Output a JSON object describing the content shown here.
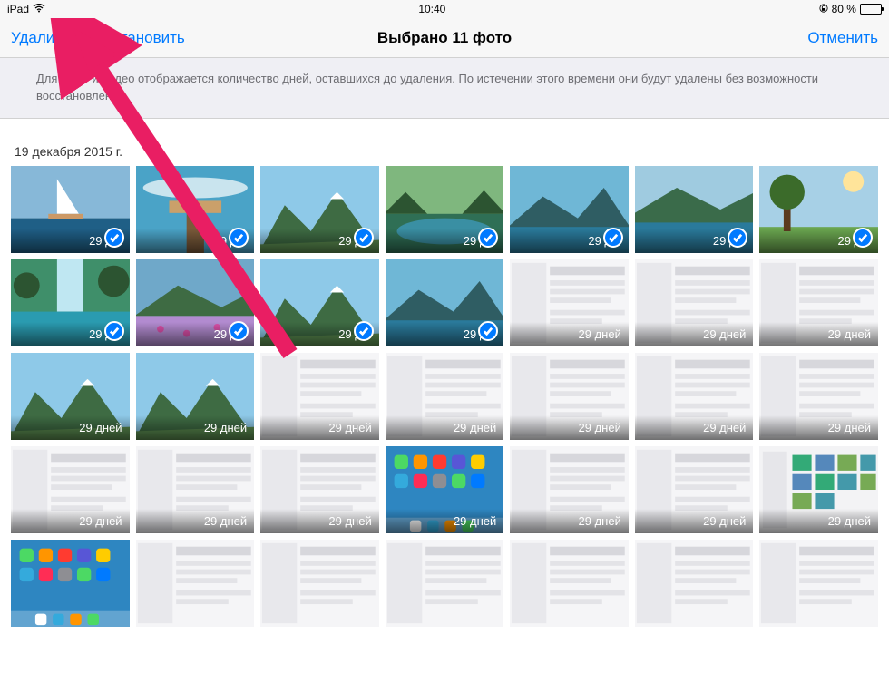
{
  "statusbar": {
    "device": "iPad",
    "time": "10:40",
    "battery_pct": "80 %"
  },
  "nav": {
    "delete": "Удалить",
    "recover": "Восстановить",
    "title": "Выбрано 11 фото",
    "cancel": "Отменить"
  },
  "info": "Для фото и видео отображается количество дней, оставшихся до удаления. По истечении этого времени они будут удалены без возможности восстановления.",
  "section_date": "19 декабря 2015 г.",
  "thumbs": [
    {
      "kind": "sailboat",
      "days": "29 д...",
      "selected": true
    },
    {
      "kind": "pier",
      "days": "29 д...",
      "selected": true
    },
    {
      "kind": "mountain1",
      "days": "29 д...",
      "selected": true
    },
    {
      "kind": "forestlake",
      "days": "29 д...",
      "selected": true
    },
    {
      "kind": "mountain2",
      "days": "29 д...",
      "selected": true
    },
    {
      "kind": "lake",
      "days": "29 д...",
      "selected": true
    },
    {
      "kind": "tree",
      "days": "29 д...",
      "selected": true
    },
    {
      "kind": "waterfall",
      "days": "29 д...",
      "selected": true
    },
    {
      "kind": "flowers",
      "days": "29 д...",
      "selected": true
    },
    {
      "kind": "mountain1",
      "days": "29 д...",
      "selected": true
    },
    {
      "kind": "mountain2",
      "days": "29 д...",
      "selected": true
    },
    {
      "kind": "screenshot",
      "days": "29 дней",
      "selected": false
    },
    {
      "kind": "screenshot",
      "days": "29 дней",
      "selected": false
    },
    {
      "kind": "screenshot",
      "days": "29 дней",
      "selected": false
    },
    {
      "kind": "mountain1",
      "days": "29 дней",
      "selected": false
    },
    {
      "kind": "mountain1",
      "days": "29 дней",
      "selected": false
    },
    {
      "kind": "screenshot",
      "days": "29 дней",
      "selected": false
    },
    {
      "kind": "screenshot",
      "days": "29 дней",
      "selected": false
    },
    {
      "kind": "screenshot",
      "days": "29 дней",
      "selected": false
    },
    {
      "kind": "screenshot",
      "days": "29 дней",
      "selected": false
    },
    {
      "kind": "screenshot",
      "days": "29 дней",
      "selected": false
    },
    {
      "kind": "screenshot",
      "days": "29 дней",
      "selected": false
    },
    {
      "kind": "screenshot",
      "days": "29 дней",
      "selected": false
    },
    {
      "kind": "screenshot",
      "days": "29 дней",
      "selected": false
    },
    {
      "kind": "homescreen",
      "days": "29 дней",
      "selected": false
    },
    {
      "kind": "screenshot",
      "days": "29 дней",
      "selected": false
    },
    {
      "kind": "screenshot",
      "days": "29 дней",
      "selected": false
    },
    {
      "kind": "photogrid",
      "days": "29 дней",
      "selected": false
    },
    {
      "kind": "homescreen",
      "days": "",
      "selected": false
    },
    {
      "kind": "screenshot",
      "days": "",
      "selected": false
    },
    {
      "kind": "screenshot",
      "days": "",
      "selected": false
    },
    {
      "kind": "screenshot",
      "days": "",
      "selected": false
    },
    {
      "kind": "screenshot",
      "days": "",
      "selected": false
    },
    {
      "kind": "screenshot",
      "days": "",
      "selected": false
    },
    {
      "kind": "screenshot",
      "days": "",
      "selected": false
    }
  ],
  "colors": {
    "tint": "#007aff",
    "arrow": "#e91e63"
  }
}
